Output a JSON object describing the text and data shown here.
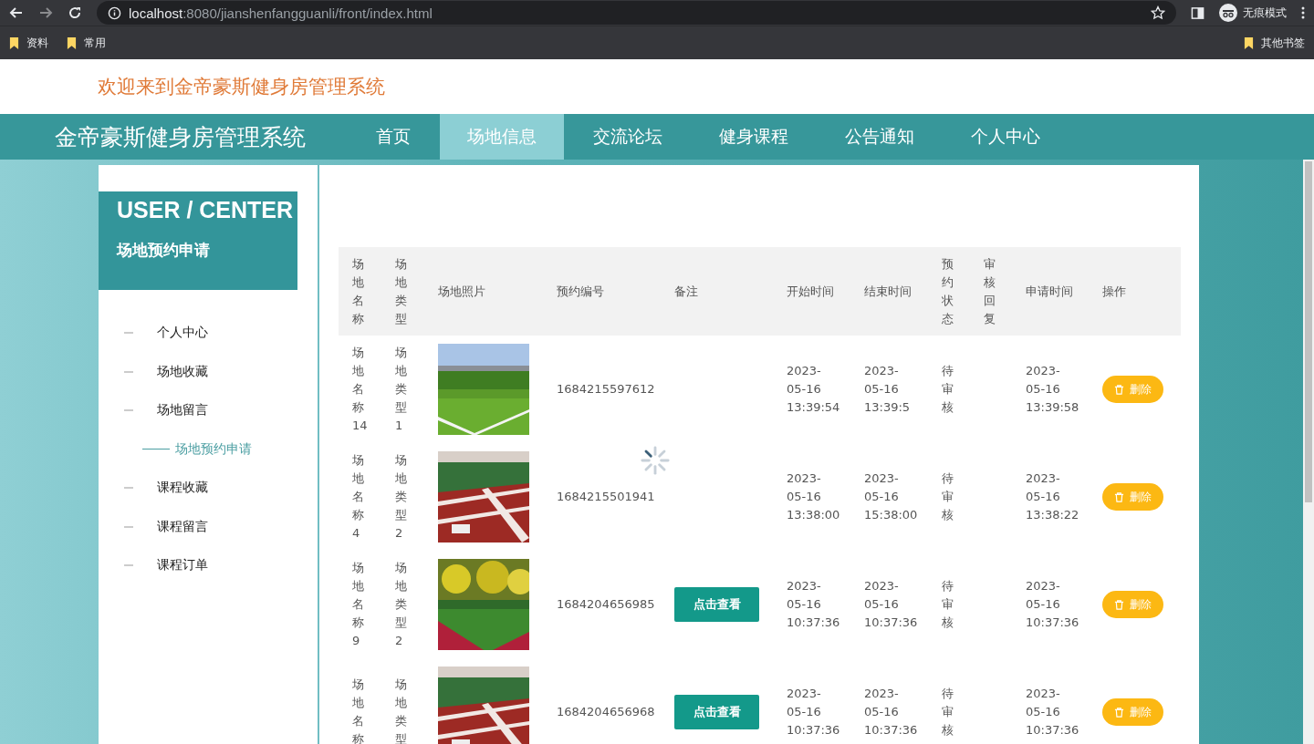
{
  "browser": {
    "url_host": "localhost",
    "url_path": ":8080/jianshenfangguanli/front/index.html",
    "profile_label": "无痕模式",
    "bookmarks": [
      "资料",
      "常用"
    ],
    "other_bookmarks": "其他书签"
  },
  "header": {
    "welcome": "欢迎来到金帝豪斯健身房管理系统"
  },
  "nav": {
    "brand": "金帝豪斯健身房管理系统",
    "items": [
      {
        "label": "首页",
        "selected": false
      },
      {
        "label": "场地信息",
        "selected": true
      },
      {
        "label": "交流论坛",
        "selected": false
      },
      {
        "label": "健身课程",
        "selected": false
      },
      {
        "label": "公告通知",
        "selected": false
      },
      {
        "label": "个人中心",
        "selected": false
      }
    ]
  },
  "sidebar": {
    "title": "USER / CENTER",
    "subtitle": "场地预约申请",
    "items": [
      {
        "label": "个人中心",
        "selected": false
      },
      {
        "label": "场地收藏",
        "selected": false
      },
      {
        "label": "场地留言",
        "selected": false
      },
      {
        "label": "场地预约申请",
        "selected": true
      },
      {
        "label": "课程收藏",
        "selected": false
      },
      {
        "label": "课程留言",
        "selected": false
      },
      {
        "label": "课程订单",
        "selected": false
      }
    ]
  },
  "table": {
    "columns": [
      "场地名称",
      "场地类型",
      "场地照片",
      "预约编号",
      "备注",
      "开始时间",
      "结束时间",
      "预约状态",
      "审核回复",
      "申请时间",
      "操作"
    ],
    "rows": [
      {
        "name": "场地名称14",
        "type": "场地类型1",
        "booking_no": "1684215597612",
        "start": "2023-05-16 13:39:54",
        "end": "2023-05-16 13:39:5",
        "status": "待审核",
        "apply_time": "2023-05-16 13:39:58",
        "action": "删除"
      },
      {
        "name": "场地名称4",
        "type": "场地类型2",
        "booking_no": "1684215501941",
        "start": "2023-05-16 13:38:00",
        "end": "2023-05-16 15:38:00",
        "status": "待审核",
        "apply_time": "2023-05-16 13:38:22",
        "action": "删除"
      },
      {
        "name": "场地名称9",
        "type": "场地类型2",
        "booking_no": "1684204656985",
        "remark": {
          "kind": "button",
          "label": "点击查看"
        },
        "start": "2023-05-16 10:37:36",
        "end": "2023-05-16 10:37:36",
        "status": "待审核",
        "apply_time": "2023-05-16 10:37:36",
        "action": "删除"
      },
      {
        "name": "场地名称",
        "type": "场地类型",
        "booking_no": "1684204656968",
        "remark": {
          "kind": "button",
          "label": "点击查看"
        },
        "start": "2023-05-16 10:37:36",
        "end": "2023-05-16 10:37:36",
        "status": "待审核",
        "apply_time": "2023-05-16 10:37:36",
        "action": "删除"
      }
    ]
  }
}
